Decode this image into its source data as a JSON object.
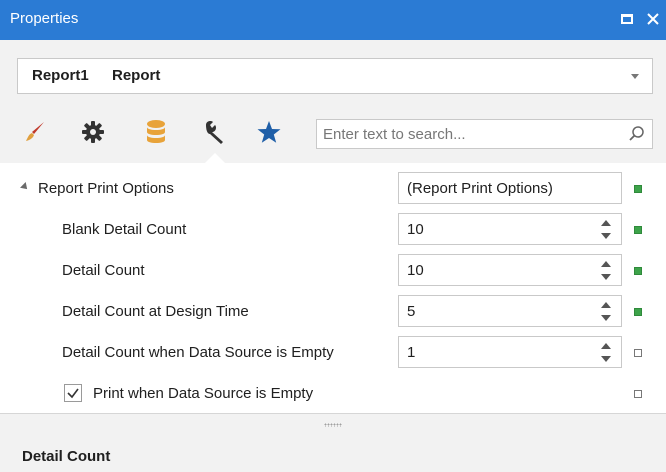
{
  "window": {
    "title": "Properties",
    "buttons": [
      "maximize",
      "close"
    ]
  },
  "object_selector": {
    "name": "Report1",
    "type": "Report"
  },
  "toolbar": {
    "tabs": [
      {
        "icon": "brush-icon",
        "color": "#c0392b"
      },
      {
        "icon": "gear-icon",
        "color": "#333333"
      },
      {
        "icon": "database-icon",
        "color": "#e8a33a"
      },
      {
        "icon": "wrench-icon",
        "color": "#333333",
        "active": true
      },
      {
        "icon": "star-icon",
        "color": "#1f5fa8"
      }
    ]
  },
  "search": {
    "placeholder": "Enter text to search...",
    "value": ""
  },
  "grid": {
    "category": {
      "label": "Report Print Options",
      "value": "(Report Print Options)",
      "expanded": true,
      "marker": "set"
    },
    "rows": [
      {
        "label": "Blank Detail Count",
        "value": "10",
        "marker": "set"
      },
      {
        "label": "Detail Count",
        "value": "10",
        "marker": "set"
      },
      {
        "label": "Detail Count at Design Time",
        "value": "5",
        "marker": "set"
      },
      {
        "label": "Detail Count when Data Source is Empty",
        "value": "1",
        "marker": "unset"
      }
    ],
    "checkbox_row": {
      "label": "Print when Data Source is Empty",
      "checked": true,
      "marker": "unset"
    }
  },
  "description": {
    "title": "Detail Count"
  },
  "colors": {
    "titlebar": "#2b7bd4",
    "marker_set": "#3da34a"
  }
}
